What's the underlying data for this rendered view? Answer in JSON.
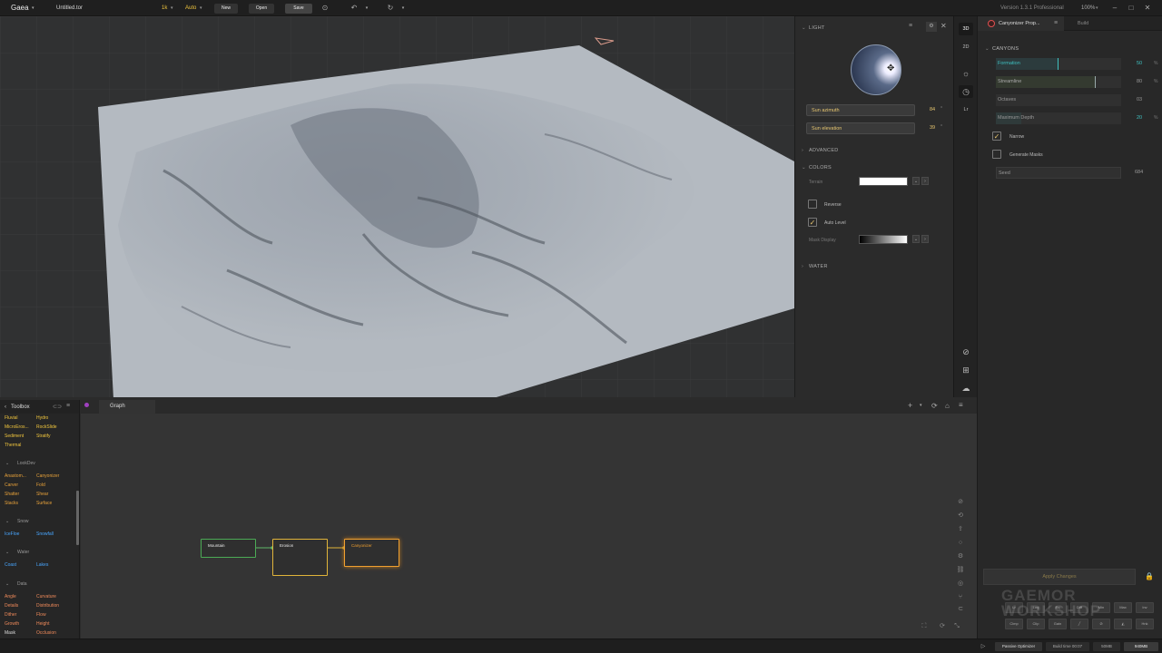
{
  "topbar": {
    "app_name": "Gaea",
    "file_name": "Untitled.tor",
    "resolution": "1k",
    "mode": "Auto",
    "new_label": "New",
    "open_label": "Open",
    "save_label": "Save",
    "version": "Version 1.3.1 Professional",
    "zoom": "100%"
  },
  "light_panel": {
    "title": "LIGHT",
    "azimuth_label": "Sun azimuth",
    "azimuth_value": "84",
    "azimuth_unit": "°",
    "elevation_label": "Sun elevation",
    "elevation_value": "39",
    "elevation_unit": "°",
    "advanced": "ADVANCED",
    "colors": "COLORS",
    "terrain_label": "Terrain",
    "reverse_label": "Reverse",
    "auto_level_label": "Auto Level",
    "mask_display_label": "Mask Display",
    "water": "WATER"
  },
  "view_tools": {
    "mode_3d": "3D",
    "mode_2d": "2D",
    "lr": "Lr"
  },
  "properties": {
    "tab_title": "Canyonizer Prop...",
    "build_tab": "Build",
    "section": "CANYONS",
    "rows": [
      {
        "label": "Formation",
        "value": "50",
        "unit": "%",
        "fill": 0.5
      },
      {
        "label": "Streamline",
        "value": "80",
        "unit": "%",
        "fill": 0.8
      },
      {
        "label": "Octaves",
        "value": "03",
        "unit": "",
        "fill": 0
      },
      {
        "label": "Maximum Depth",
        "value": "20",
        "unit": "%",
        "fill": 0.2
      }
    ],
    "narrow_label": "Narrow",
    "generate_masks_label": "Generate Masks",
    "seed_label": "Seed",
    "seed_value": "684",
    "apply_label": "Apply Changes",
    "mini_buttons_row1": [
      "Lr",
      "Log",
      "Eq",
      "Diff",
      "Min",
      "Max",
      "Inv"
    ],
    "mini_buttons_row2": [
      "Clmp",
      "Clip",
      "Gain",
      "",
      "",
      "",
      "Hnk"
    ]
  },
  "toolbox": {
    "title": "Toolbox",
    "erosion_items": [
      [
        "Fluvial",
        "Hydro"
      ],
      [
        "MicroEros...",
        "RockSlide"
      ],
      [
        "Sediment",
        "Stratify"
      ],
      [
        "Thermal",
        ""
      ]
    ],
    "lookdev_header": "LookDev",
    "lookdev_items": [
      [
        "Anastom...",
        "Canyonizer"
      ],
      [
        "Carver",
        "Fold"
      ],
      [
        "Shatter",
        "Shear"
      ],
      [
        "Stacks",
        "Surface"
      ]
    ],
    "snow_header": "Snow",
    "snow_items": [
      [
        "IceFloe",
        "Snowfall"
      ]
    ],
    "water_header": "Water",
    "water_items": [
      [
        "Coast",
        "Lakes"
      ]
    ],
    "data_header": "Data",
    "data_items": [
      [
        "Angle",
        "Curvature"
      ],
      [
        "Details",
        "Distribution"
      ],
      [
        "Dither",
        "Flow"
      ],
      [
        "Growth",
        "Height"
      ],
      [
        "Mask",
        "Occlusion"
      ]
    ]
  },
  "graph": {
    "title": "Graph",
    "nodes": [
      "Mountain",
      "Erosion",
      "Canyonizer"
    ]
  },
  "statusbar": {
    "optimizer": "Passive Optimizer",
    "build_time": "Build time 00:07",
    "mem1": "50MB",
    "mem2": "940MB"
  },
  "watermark": "GAEMOR WORKSHOP",
  "colors": {
    "accent_yellow": "#e8c770",
    "node_green": "#4caa55",
    "node_yellow": "#e0b43a",
    "node_orange": "#f0a030",
    "teal": "#3fc0c0"
  }
}
